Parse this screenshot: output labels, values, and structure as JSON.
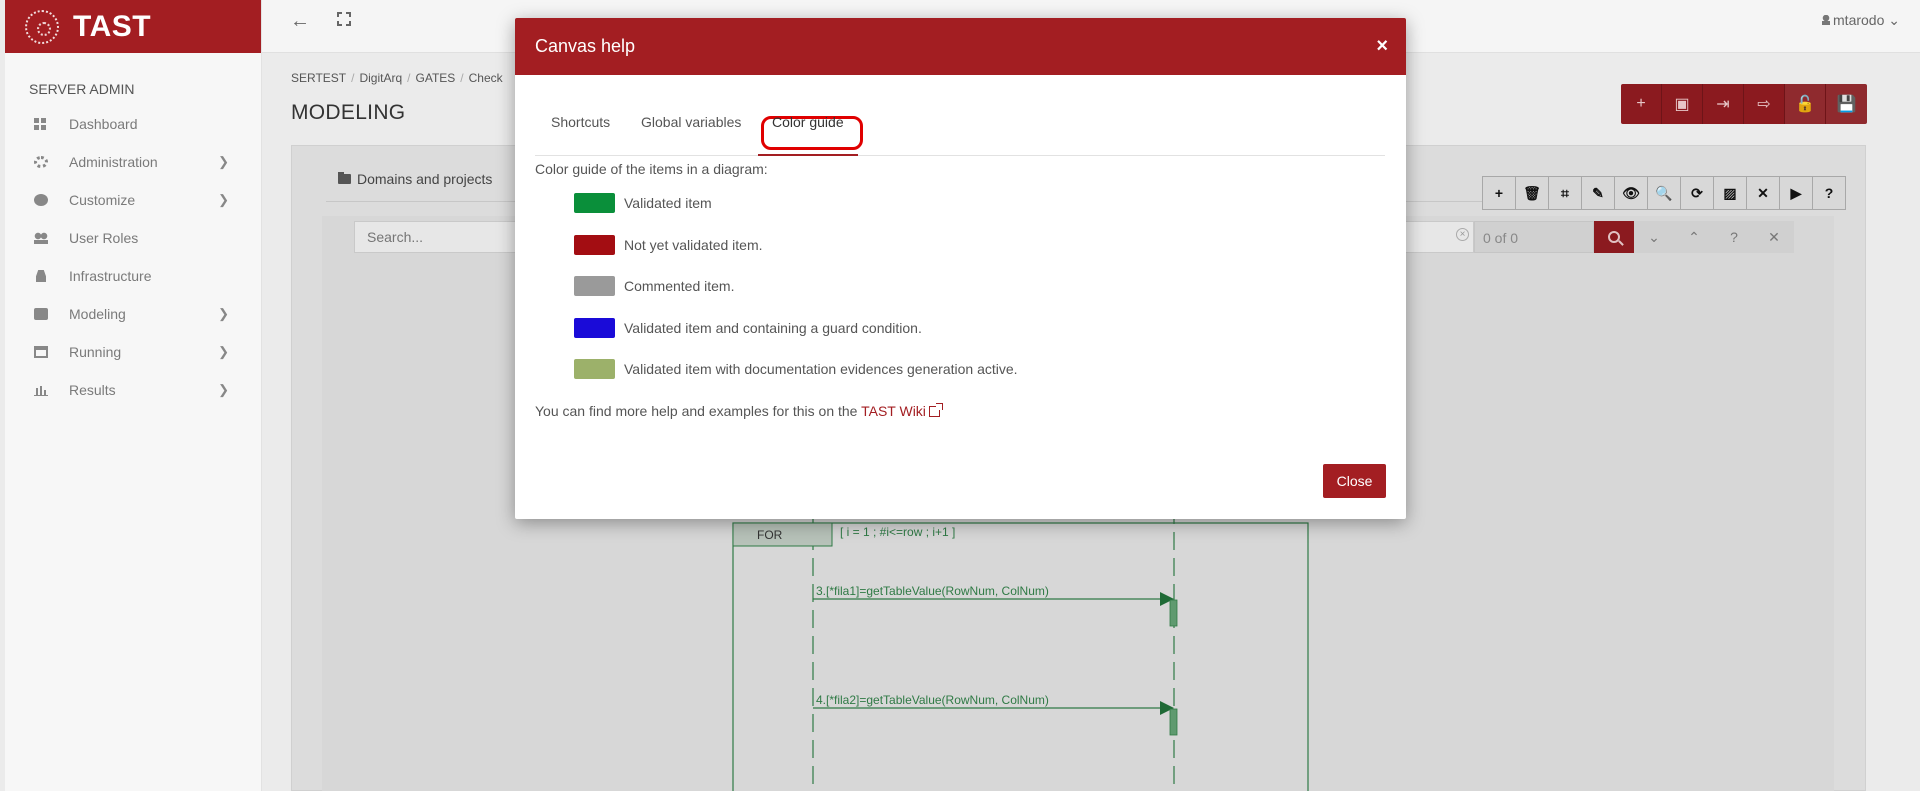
{
  "app": {
    "name": "TAST"
  },
  "sidebar": {
    "heading": "SERVER ADMIN",
    "items": [
      {
        "label": "Dashboard",
        "icon": "dashboard-icon",
        "chevron": false
      },
      {
        "label": "Administration",
        "icon": "gear-icon",
        "chevron": true
      },
      {
        "label": "Customize",
        "icon": "circle-icon",
        "chevron": true
      },
      {
        "label": "User Roles",
        "icon": "users-icon",
        "chevron": false
      },
      {
        "label": "Infrastructure",
        "icon": "road-icon",
        "chevron": false
      },
      {
        "label": "Modeling",
        "icon": "briefcase-icon",
        "chevron": true
      },
      {
        "label": "Running",
        "icon": "calendar-icon",
        "chevron": true
      },
      {
        "label": "Results",
        "icon": "bar-chart-icon",
        "chevron": true
      }
    ]
  },
  "topbar": {
    "back_icon": "←",
    "user": "mtarodo",
    "user_chevron": "⌄"
  },
  "breadcrumb": [
    "SERTEST",
    "DigitArq",
    "GATES",
    "Check"
  ],
  "page": {
    "title": "MODELING"
  },
  "actions": [
    "+",
    "▣",
    "⇥",
    "⇨",
    "🔓",
    "💾"
  ],
  "content": {
    "tab_label": "Domains and projects",
    "canvas_tools": [
      "+",
      "🗑",
      "⌗",
      "✎",
      "👁",
      "🔍",
      "⟳",
      "▨",
      "✕",
      "▶",
      "?"
    ],
    "search": {
      "placeholder": "Search...",
      "count": "0 of 0",
      "clear": "×",
      "down": "⌄",
      "up": "⌃",
      "help": "?",
      "close": "✕"
    }
  },
  "diagram": {
    "for_label": "FOR",
    "for_condition": "[ i = 1 ; #i<=row ; i+1 ]",
    "messages": [
      "3.[*fila1]=getTableValue(RowNum, ColNum)",
      "4.[*fila2]=getTableValue(RowNum, ColNum)"
    ]
  },
  "modal": {
    "title": "Canvas help",
    "close_x": "×",
    "tabs": [
      "Shortcuts",
      "Global variables",
      "Color guide"
    ],
    "active_tab": "Color guide",
    "intro": "Color guide of the items in a diagram:",
    "guide": [
      {
        "color": "#0a8f3a",
        "label": "Validated item"
      },
      {
        "color": "#a30d12",
        "label": "Not yet validated item."
      },
      {
        "color": "#9a9a9a",
        "label": "Commented item."
      },
      {
        "color": "#1a0bd8",
        "label": "Validated item and containing a guard condition."
      },
      {
        "color": "#9cb16a",
        "label": "Validated item with documentation evidences generation active."
      }
    ],
    "wiki_prefix": "You can find more help and examples for this on the ",
    "wiki_link": "TAST Wiki",
    "close_button": "Close"
  },
  "colors": {
    "brand": "#a31e22",
    "brand_dark": "#8b1a1f",
    "diagram_green": "#1f7a3a"
  }
}
